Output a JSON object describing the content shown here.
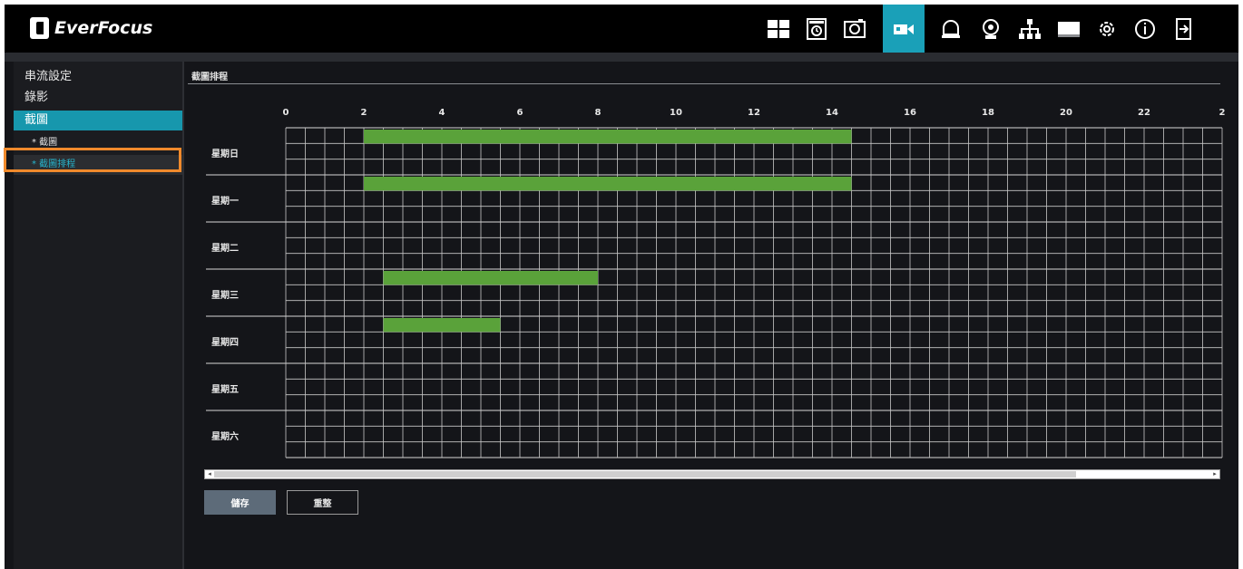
{
  "brand": {
    "name": "EverFocus"
  },
  "toolbar": {
    "icons": [
      {
        "name": "live-view-layout-icon",
        "active": false
      },
      {
        "name": "playback-icon",
        "active": false
      },
      {
        "name": "snapshot-icon",
        "active": false
      },
      {
        "name": "camera-record-icon",
        "active": true
      },
      {
        "name": "alarm-bell-icon",
        "active": false
      },
      {
        "name": "motion-detection-icon",
        "active": false
      },
      {
        "name": "network-icon",
        "active": false
      },
      {
        "name": "storage-disk-icon",
        "active": false
      },
      {
        "name": "settings-gear-icon",
        "active": false
      },
      {
        "name": "info-icon",
        "active": false
      },
      {
        "name": "logout-icon",
        "active": false
      }
    ],
    "accent": "#1aa0b8"
  },
  "sidebar": {
    "items": [
      {
        "label": "串流設定"
      },
      {
        "label": "錄影"
      },
      {
        "label": "截圖"
      }
    ],
    "subitems": [
      {
        "label": "* 截圖"
      },
      {
        "label": "* 截圖排程"
      }
    ]
  },
  "main": {
    "title": "截圖排程",
    "hours": [
      "0",
      "2",
      "4",
      "6",
      "8",
      "10",
      "12",
      "14",
      "16",
      "18",
      "20",
      "22",
      "2"
    ],
    "days": [
      "星期日",
      "星期一",
      "星期二",
      "星期三",
      "星期四",
      "星期五",
      "星期六"
    ],
    "schedule": [
      {
        "day": "星期日",
        "start": 2,
        "end": 14.5
      },
      {
        "day": "星期一",
        "start": 2,
        "end": 14.5
      },
      {
        "day": "星期三",
        "start": 2.5,
        "end": 8
      },
      {
        "day": "星期四",
        "start": 2.5,
        "end": 5.5
      }
    ],
    "schedule_color": "#5aa23a",
    "buttons": {
      "save": "儲存",
      "reset": "重整"
    }
  }
}
